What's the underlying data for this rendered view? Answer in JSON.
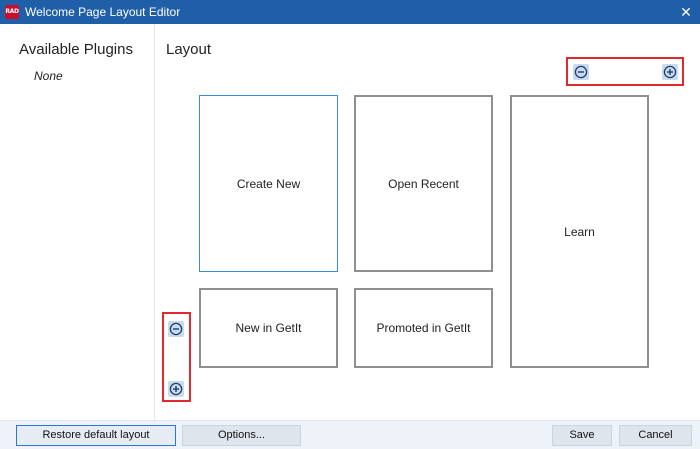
{
  "window": {
    "app_icon_text": "RAD",
    "title": "Welcome Page Layout Editor",
    "close_glyph": "✕"
  },
  "plugins": {
    "heading": "Available Plugins",
    "empty_text": "None"
  },
  "layout": {
    "heading": "Layout",
    "tiles": [
      {
        "label": "Create New",
        "selected": true
      },
      {
        "label": "Open Recent",
        "selected": false
      },
      {
        "label": "Learn",
        "selected": false
      },
      {
        "label": "New in GetIt",
        "selected": false
      },
      {
        "label": "Promoted in GetIt",
        "selected": false
      }
    ],
    "column_controls": {
      "remove_icon": "minus-circle-icon",
      "add_icon": "plus-circle-icon"
    },
    "row_controls": {
      "remove_icon": "minus-circle-icon",
      "add_icon": "plus-circle-icon"
    },
    "highlight_color": "#e0282e",
    "selected_color": "#3c8ad8"
  },
  "footer": {
    "restore_label": "Restore default layout",
    "options_label": "Options...",
    "save_label": "Save",
    "cancel_label": "Cancel"
  },
  "colors": {
    "titlebar": "#1f5fa7",
    "footer_bg": "#eef3f9"
  }
}
